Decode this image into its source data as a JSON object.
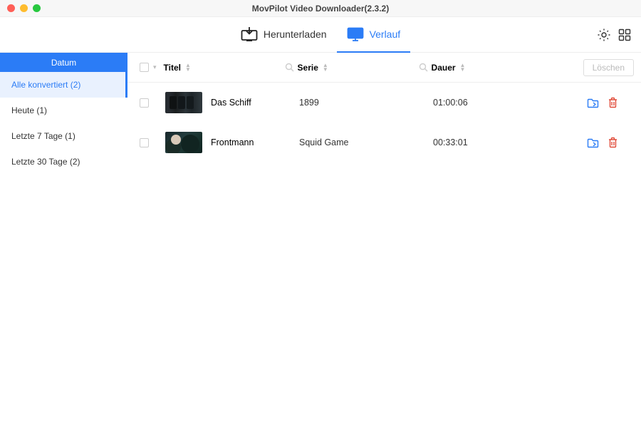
{
  "window": {
    "title": "MovPilot Video Downloader(2.3.2)"
  },
  "tabs": {
    "download": "Herunterladen",
    "history": "Verlauf"
  },
  "sidebar": {
    "header": "Datum",
    "items": [
      {
        "label": "Alle konvertiert (2)",
        "selected": true
      },
      {
        "label": "Heute (1)",
        "selected": false
      },
      {
        "label": "Letzte 7 Tage (1)",
        "selected": false
      },
      {
        "label": "Letzte 30 Tage (2)",
        "selected": false
      }
    ]
  },
  "table": {
    "headers": {
      "title": "Titel",
      "serie": "Serie",
      "duration": "Dauer",
      "delete": "Löschen"
    },
    "rows": [
      {
        "title": "Das Schiff",
        "serie": "1899",
        "duration": "01:00:06"
      },
      {
        "title": "Frontmann",
        "serie": "Squid Game",
        "duration": "00:33:01"
      }
    ]
  },
  "icons": {
    "download": "download-into-screen-icon",
    "monitor": "monitor-icon",
    "settings": "gear-icon",
    "grid": "grid-icon",
    "search": "search-icon",
    "sort": "sort-icon",
    "folder": "open-folder-icon",
    "trash": "trash-icon"
  }
}
